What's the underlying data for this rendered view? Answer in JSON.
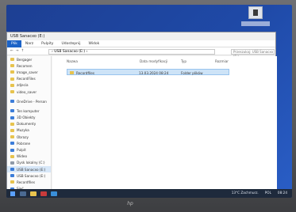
{
  "desktop": {
    "icon_name": "desktop-file-icon"
  },
  "window": {
    "title": "USB Sanacxo (E:)",
    "ribbon_tabs": [
      "Plik",
      "Narz",
      "Pulpity",
      "Udostepnij",
      "Widok"
    ],
    "address_path": "› USB Sanacxo (E:)  ›",
    "search_placeholder": "Przeszukaj: USB Sanacxo (E:)",
    "nav_back": "←",
    "nav_fwd": "→",
    "nav_up": "↑"
  },
  "sidebar": {
    "items": [
      {
        "label": "Bergager",
        "icon": "folder-icon"
      },
      {
        "label": "Recomen",
        "icon": "folder-icon"
      },
      {
        "label": "Image_saver",
        "icon": "folder-icon"
      },
      {
        "label": "RecordFiles",
        "icon": "folder-icon"
      },
      {
        "label": "zdjecia",
        "icon": "folder-icon"
      },
      {
        "label": "video_saver",
        "icon": "folder-icon"
      },
      {
        "label": "OneDrive - Person",
        "icon": "cloud-icon"
      },
      {
        "label": "Ten komputer",
        "icon": "computer-icon"
      },
      {
        "label": "3D Obiekty",
        "icon": "cube-icon"
      },
      {
        "label": "Dokumenty",
        "icon": "folder-icon"
      },
      {
        "label": "Muzyka",
        "icon": "music-icon"
      },
      {
        "label": "Obrazy",
        "icon": "image-icon"
      },
      {
        "label": "Pobrane",
        "icon": "download-icon"
      },
      {
        "label": "Pulpit",
        "icon": "desktop-icon"
      },
      {
        "label": "Wideo",
        "icon": "video-icon"
      },
      {
        "label": "Dysk lokalny (C:)",
        "icon": "drive-icon"
      },
      {
        "label": "USB Sanacxo (E:)",
        "icon": "usb-icon"
      },
      {
        "label": "USB Sanacxo (E:)",
        "icon": "usb-icon"
      },
      {
        "label": "Recordfiles",
        "icon": "folder-icon"
      },
      {
        "label": "Sieć",
        "icon": "network-icon"
      }
    ]
  },
  "columns": [
    "Nazwa",
    "Data modyfikacji",
    "Typ",
    "Rozmiar"
  ],
  "files": [
    {
      "name": "Recordfiles",
      "modified": "13.03.2024 08:24",
      "type": "Folder plików",
      "size": ""
    }
  ],
  "taskbar": {
    "weather": "13°C Zachmurz.",
    "time": "08:24",
    "lang": "POL"
  },
  "bezel": {
    "logo": "hp"
  }
}
